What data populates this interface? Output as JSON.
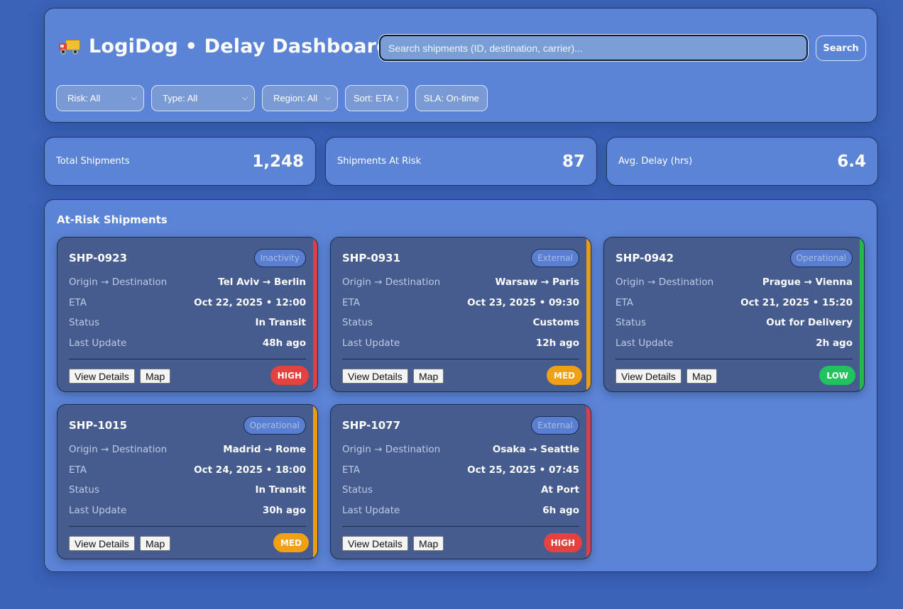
{
  "header": {
    "title": "LogiDog • Delay Dashboard",
    "logo_icon": "truck-icon",
    "search": {
      "placeholder": "Search shipments (ID, destination, carrier)...",
      "value": "",
      "button_label": "Search"
    },
    "filters": [
      {
        "label": "Risk: All",
        "kind": "select"
      },
      {
        "label": "Type: All",
        "kind": "select"
      },
      {
        "label": "Region: All",
        "kind": "select"
      },
      {
        "label": "Sort: ETA ↑",
        "kind": "button"
      },
      {
        "label": "SLA: On-time",
        "kind": "button"
      }
    ]
  },
  "stats": [
    {
      "label": "Total Shipments",
      "value": "1,248"
    },
    {
      "label": "Shipments At Risk",
      "value": "87"
    },
    {
      "label": "Avg. Delay (hrs)",
      "value": "6.4"
    }
  ],
  "at_risk": {
    "title": "At-Risk Shipments",
    "field_labels": {
      "route": "Origin → Destination",
      "eta": "ETA",
      "status": "Status",
      "last_update": "Last Update"
    },
    "actions": {
      "details": "View Details",
      "map": "Map"
    },
    "risk_colors": {
      "HIGH": "#e5413e",
      "MED": "#f0a014",
      "LOW": "#22c35e"
    },
    "cards": [
      {
        "id": "SHP-0923",
        "tag": "Inactivity",
        "route": "Tel Aviv → Berlin",
        "eta": "Oct 22, 2025 • 12:00",
        "status": "In Transit",
        "last_update": "48h ago",
        "risk": "HIGH",
        "stripe": "#d9404a"
      },
      {
        "id": "SHP-0931",
        "tag": "External",
        "route": "Warsaw → Paris",
        "eta": "Oct 23, 2025 • 09:30",
        "status": "Customs",
        "last_update": "12h ago",
        "risk": "MED",
        "stripe": "#e89c12"
      },
      {
        "id": "SHP-0942",
        "tag": "Operational",
        "route": "Prague → Vienna",
        "eta": "Oct 21, 2025 • 15:20",
        "status": "Out for Delivery",
        "last_update": "2h ago",
        "risk": "LOW",
        "stripe": "#22b84e"
      },
      {
        "id": "SHP-1015",
        "tag": "Operational",
        "route": "Madrid → Rome",
        "eta": "Oct 24, 2025 • 18:00",
        "status": "In Transit",
        "last_update": "30h ago",
        "risk": "MED",
        "stripe": "#e89c12"
      },
      {
        "id": "SHP-1077",
        "tag": "External",
        "route": "Osaka → Seattle",
        "eta": "Oct 25, 2025 • 07:45",
        "status": "At Port",
        "last_update": "6h ago",
        "risk": "HIGH",
        "stripe": "#d9404a"
      }
    ]
  }
}
